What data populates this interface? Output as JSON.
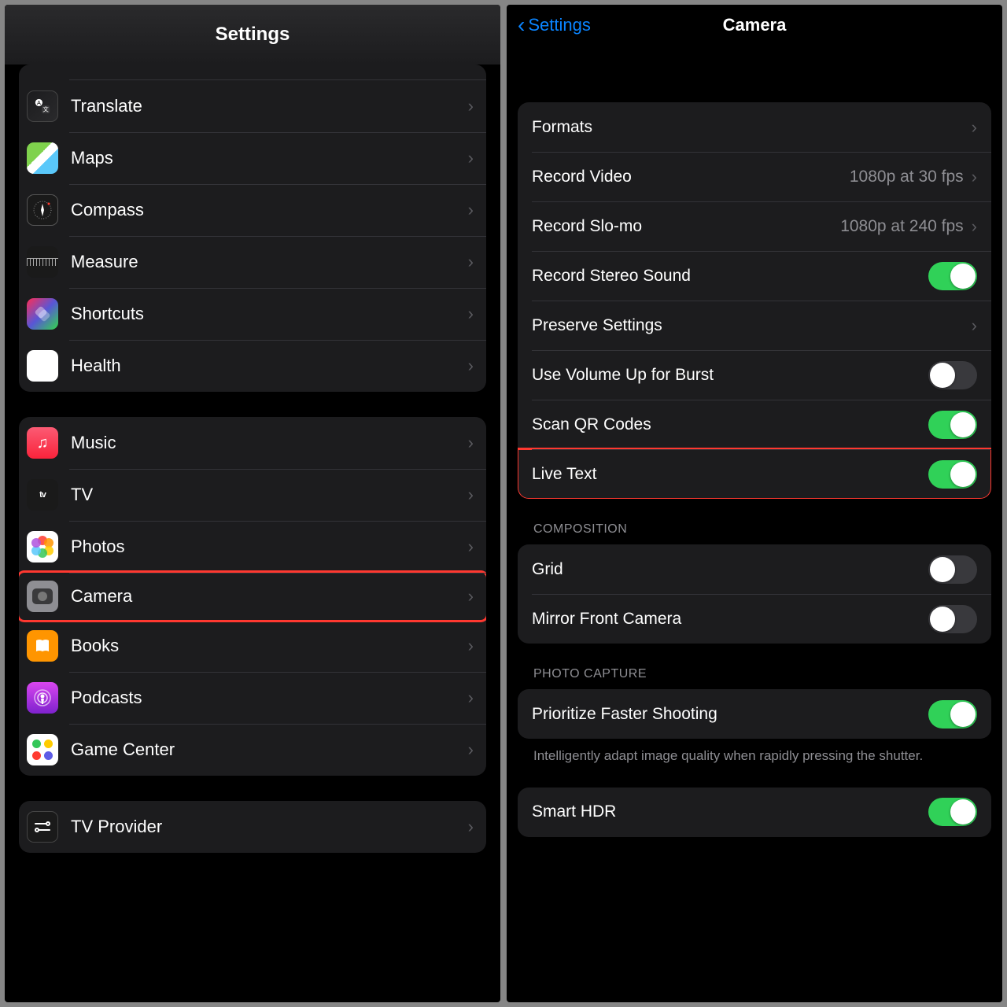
{
  "left": {
    "title": "Settings",
    "group1": {
      "translate": "Translate",
      "maps": "Maps",
      "compass": "Compass",
      "measure": "Measure",
      "shortcuts": "Shortcuts",
      "health": "Health"
    },
    "group2": {
      "music": "Music",
      "tv": "TV",
      "photos": "Photos",
      "camera": "Camera",
      "books": "Books",
      "podcasts": "Podcasts",
      "gamecenter": "Game Center"
    },
    "group3": {
      "tvprovider": "TV Provider"
    }
  },
  "right": {
    "back": "Settings",
    "title": "Camera",
    "rows": {
      "formats": "Formats",
      "recordVideo": "Record Video",
      "recordVideoVal": "1080p at 30 fps",
      "recordSlomo": "Record Slo-mo",
      "recordSlomoVal": "1080p at 240 fps",
      "stereo": "Record Stereo Sound",
      "preserve": "Preserve Settings",
      "volBurst": "Use Volume Up for Burst",
      "scanQR": "Scan QR Codes",
      "liveText": "Live Text"
    },
    "composition": {
      "header": "Composition",
      "grid": "Grid",
      "mirror": "Mirror Front Camera"
    },
    "capture": {
      "header": "Photo Capture",
      "pfs": "Prioritize Faster Shooting",
      "pfsFooter": "Intelligently adapt image quality when rapidly pressing the shutter.",
      "hdr": "Smart HDR"
    },
    "toggles": {
      "stereo": true,
      "volBurst": false,
      "scanQR": true,
      "liveText": true,
      "grid": false,
      "mirror": false,
      "pfs": true,
      "hdr": true
    }
  }
}
